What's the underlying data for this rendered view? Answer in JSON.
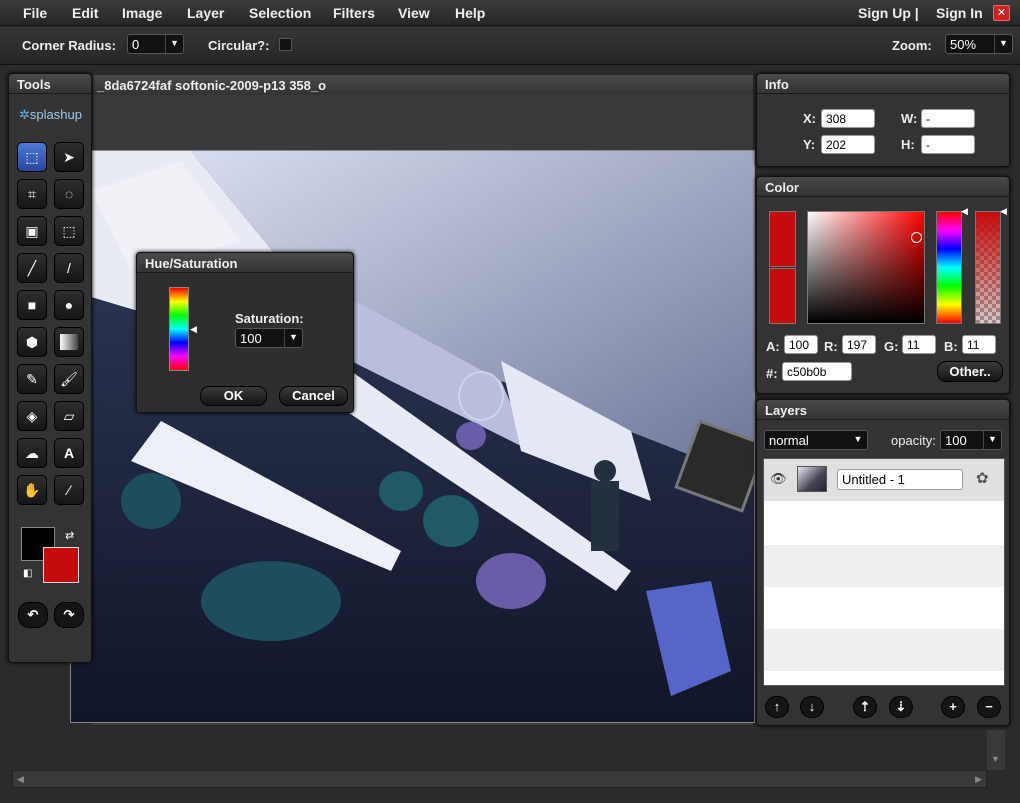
{
  "menu": {
    "file": "File",
    "edit": "Edit",
    "image": "Image",
    "layer": "Layer",
    "selection": "Selection",
    "filters": "Filters",
    "view": "View",
    "help": "Help",
    "signup": "Sign Up |",
    "signin": "Sign In"
  },
  "options": {
    "corner_radius_label": "Corner Radius:",
    "corner_radius_value": "0",
    "circular_label": "Circular?:",
    "zoom_label": "Zoom:",
    "zoom_value": "50%"
  },
  "tools": {
    "title": "Tools",
    "logo": "splashup"
  },
  "document": {
    "title": "_8da6724faf softonic-2009-p13 358_o"
  },
  "hue_sat": {
    "title": "Hue/Saturation",
    "saturation_label": "Saturation:",
    "saturation_value": "100",
    "ok": "OK",
    "cancel": "Cancel"
  },
  "info": {
    "title": "Info",
    "x_label": "X:",
    "x_value": "308",
    "y_label": "Y:",
    "y_value": "202",
    "w_label": "W:",
    "w_value": "-",
    "h_label": "H:",
    "h_value": "-"
  },
  "color": {
    "title": "Color",
    "a_label": "A:",
    "a_value": "100",
    "r_label": "R:",
    "r_value": "197",
    "g_label": "G:",
    "g_value": "11",
    "b_label": "B:",
    "b_value": "11",
    "hex_label": "#:",
    "hex_value": "c50b0b",
    "other": "Other..",
    "current": "#c50b0b"
  },
  "layers": {
    "title": "Layers",
    "blend": "normal",
    "opacity_label": "opacity:",
    "opacity_value": "100",
    "items": [
      {
        "name": "Untitled - 1"
      }
    ]
  },
  "colors": {
    "accent": "#c50b0b",
    "bg": "#2b2b2b"
  }
}
